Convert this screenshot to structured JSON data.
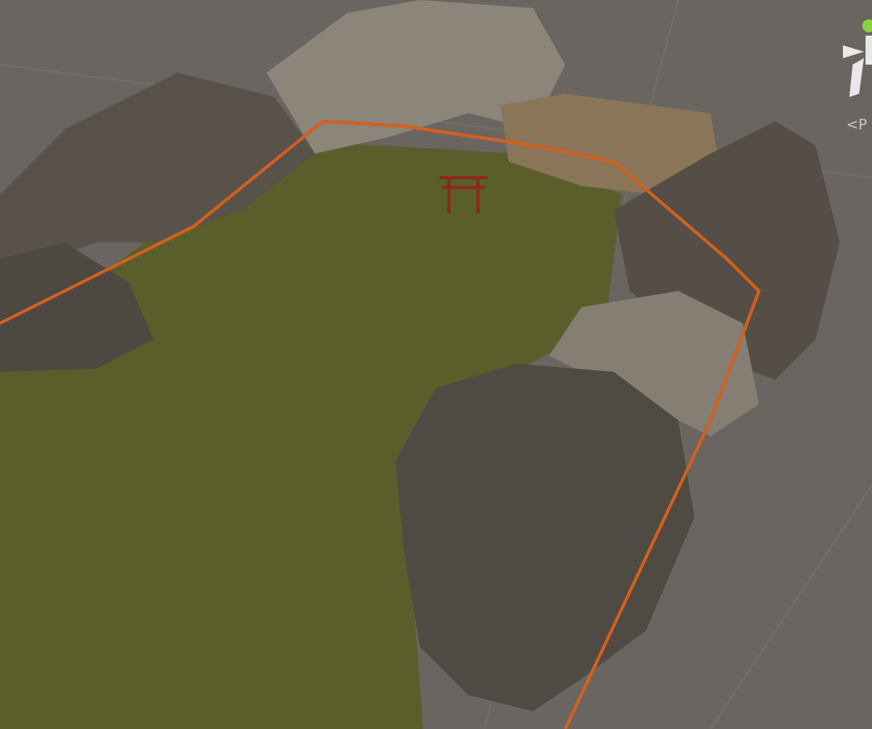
{
  "scene_view": {
    "projection_label": "<P"
  }
}
